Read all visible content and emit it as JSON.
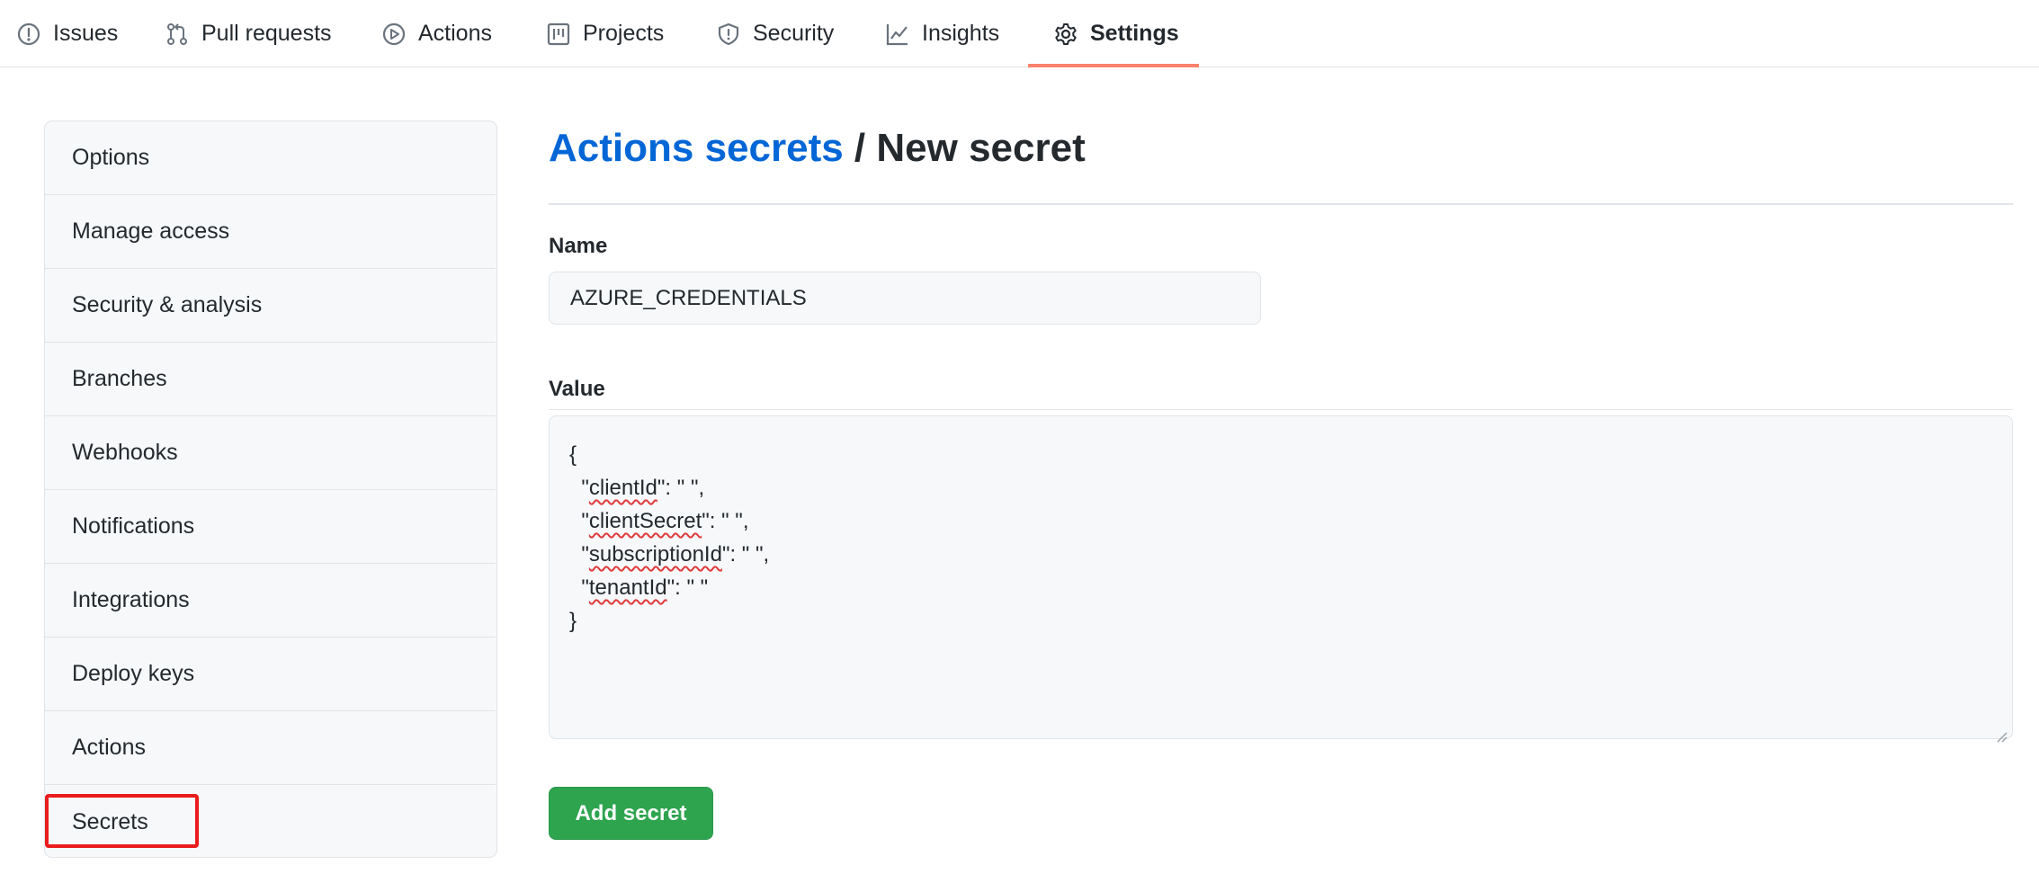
{
  "tabs": [
    {
      "label": "Issues",
      "icon": "issue-opened-icon"
    },
    {
      "label": "Pull requests",
      "icon": "git-pull-request-icon"
    },
    {
      "label": "Actions",
      "icon": "play-icon"
    },
    {
      "label": "Projects",
      "icon": "project-icon"
    },
    {
      "label": "Security",
      "icon": "shield-icon"
    },
    {
      "label": "Insights",
      "icon": "graph-icon"
    },
    {
      "label": "Settings",
      "icon": "gear-icon",
      "selected": true
    }
  ],
  "sidebar": {
    "items": [
      {
        "label": "Options"
      },
      {
        "label": "Manage access"
      },
      {
        "label": "Security & analysis"
      },
      {
        "label": "Branches"
      },
      {
        "label": "Webhooks"
      },
      {
        "label": "Notifications"
      },
      {
        "label": "Integrations"
      },
      {
        "label": "Deploy keys"
      },
      {
        "label": "Actions"
      },
      {
        "label": "Secrets",
        "highlighted": true
      }
    ]
  },
  "header": {
    "breadcrumb_link": "Actions secrets",
    "separator": " / ",
    "title": "New secret"
  },
  "form": {
    "name_label": "Name",
    "name_value": "AZURE_CREDENTIALS",
    "value_label": "Value",
    "value_lines": [
      {
        "pre": "{",
        "word": "",
        "post": ""
      },
      {
        "pre": "  \"",
        "word": "clientId",
        "post": "\": \" \","
      },
      {
        "pre": "  \"",
        "word": "clientSecret",
        "post": "\": \" \","
      },
      {
        "pre": "  \"",
        "word": "subscriptionId",
        "post": "\": \" \","
      },
      {
        "pre": "  \"",
        "word": "tenantId",
        "post": "\": \" \""
      },
      {
        "pre": "}",
        "word": "",
        "post": ""
      }
    ],
    "submit_label": "Add secret"
  },
  "colors": {
    "link": "#0366d6",
    "selected_tab_underline": "#f9826c",
    "primary_button": "#2ea44f",
    "highlight_box": "#ea1c1c"
  }
}
